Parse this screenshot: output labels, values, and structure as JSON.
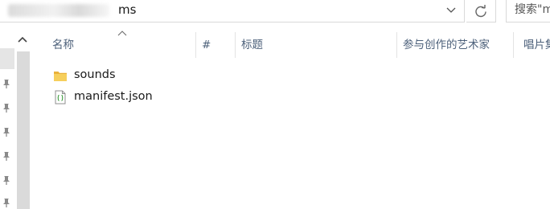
{
  "address_bar": {
    "current_folder": "ms"
  },
  "search": {
    "placeholder": "搜索\"m"
  },
  "columns": {
    "name": "名称",
    "number": "#",
    "title": "标题",
    "contributing_artists": "参与创作的艺术家",
    "album": "唱片集"
  },
  "files": [
    {
      "name": "sounds",
      "type": "folder",
      "icon": "folder-icon"
    },
    {
      "name": "manifest.json",
      "type": "file",
      "icon": "json-file-icon"
    }
  ],
  "colors": {
    "header_text": "#4c607a",
    "folder_yellow": "#f3c447",
    "json_brace_green": "#3a9b3a"
  }
}
